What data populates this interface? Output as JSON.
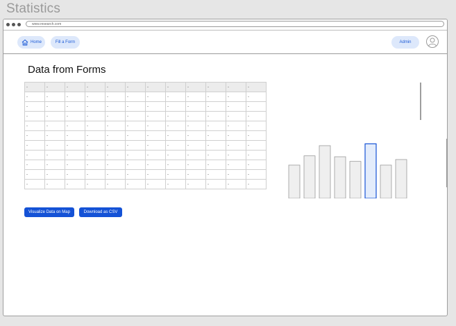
{
  "page_title": "Statistics",
  "browser": {
    "url": "www.research.com"
  },
  "nav": {
    "home_label": "Home",
    "form_label": "Fill a Form",
    "admin_label": "Admin",
    "home_icon": "home-icon",
    "avatar_icon": "user-avatar-icon"
  },
  "section_title": "Data from Forms",
  "table": {
    "header": [
      "-",
      "-",
      "-",
      "-",
      "-",
      "-",
      "-",
      "-",
      "-",
      "-",
      "-",
      "-"
    ],
    "rows": [
      [
        "-",
        "-",
        "-",
        "-",
        "-",
        "-",
        "-",
        "-",
        "-",
        "-",
        "-",
        "-"
      ],
      [
        "-",
        "-",
        "-",
        "-",
        "-",
        "-",
        "-",
        "-",
        "-",
        "-",
        "-",
        "-"
      ],
      [
        "-",
        "-",
        "-",
        "-",
        "-",
        "-",
        "-",
        "-",
        "-",
        "-",
        "-",
        "-"
      ],
      [
        "-",
        "-",
        "-",
        "-",
        "-",
        "-",
        "-",
        "-",
        "-",
        "-",
        "-",
        "-"
      ],
      [
        "-",
        "-",
        "-",
        "-",
        "-",
        "-",
        "-",
        "-",
        "-",
        "-",
        "-",
        "-"
      ],
      [
        "-",
        "-",
        "-",
        "-",
        "-",
        "-",
        "-",
        "-",
        "-",
        "-",
        "-",
        "-"
      ],
      [
        "-",
        "-",
        "-",
        "-",
        "-",
        "-",
        "-",
        "-",
        "-",
        "-",
        "-",
        "-"
      ],
      [
        "-",
        "-",
        "-",
        "-",
        "-",
        "-",
        "-",
        "-",
        "-",
        "-",
        "-",
        "-"
      ],
      [
        "-",
        "-",
        "-",
        "-",
        "-",
        "-",
        "-",
        "-",
        "-",
        "-",
        "-",
        "-"
      ],
      [
        "-",
        "-",
        "-",
        "-",
        "-",
        "-",
        "-",
        "-",
        "-",
        "-",
        "-",
        "-"
      ]
    ]
  },
  "buttons": {
    "visualize": "Visualize Data on Map",
    "download": "Download as CSV"
  },
  "colors": {
    "accent": "#1452d6",
    "pill_bg": "#dde8fb",
    "bar_fill": "#efefef",
    "bar_highlight": "#e3ecfb"
  },
  "chart_data": {
    "type": "bar",
    "values": [
      3.6,
      4.6,
      5.7,
      4.5,
      4.0,
      5.9,
      3.6,
      4.2
    ],
    "highlight_index": 5,
    "ylim": [
      0,
      6
    ]
  }
}
